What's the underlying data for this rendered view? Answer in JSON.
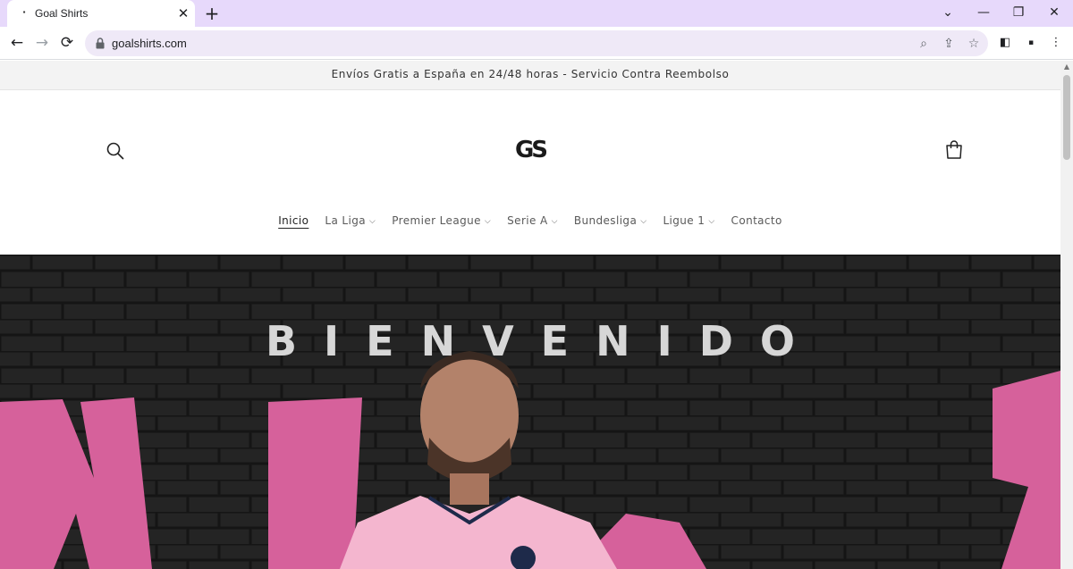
{
  "browser": {
    "tab_title": "Goal Shirts",
    "url": "goalshirts.com"
  },
  "announcement": "Envíos Gratis a España en 24/48 horas - Servicio Contra Reembolso",
  "logo": {
    "text": "GS"
  },
  "nav": {
    "items": [
      {
        "label": "Inicio",
        "has_dropdown": false,
        "active": true
      },
      {
        "label": "La Liga",
        "has_dropdown": true,
        "active": false
      },
      {
        "label": "Premier League",
        "has_dropdown": true,
        "active": false
      },
      {
        "label": "Serie A",
        "has_dropdown": true,
        "active": false
      },
      {
        "label": "Bundesliga",
        "has_dropdown": true,
        "active": false
      },
      {
        "label": "Ligue 1",
        "has_dropdown": true,
        "active": false
      },
      {
        "label": "Contacto",
        "has_dropdown": false,
        "active": false
      }
    ]
  },
  "hero": {
    "title": "BIENVENIDO",
    "accent_color": "#d6619b",
    "background_color": "#1e1e1e",
    "shirt_color": "#f4b6cf"
  },
  "colors": {
    "tab_strip": "#e7d9fb",
    "omnibox": "#efe9f7"
  }
}
